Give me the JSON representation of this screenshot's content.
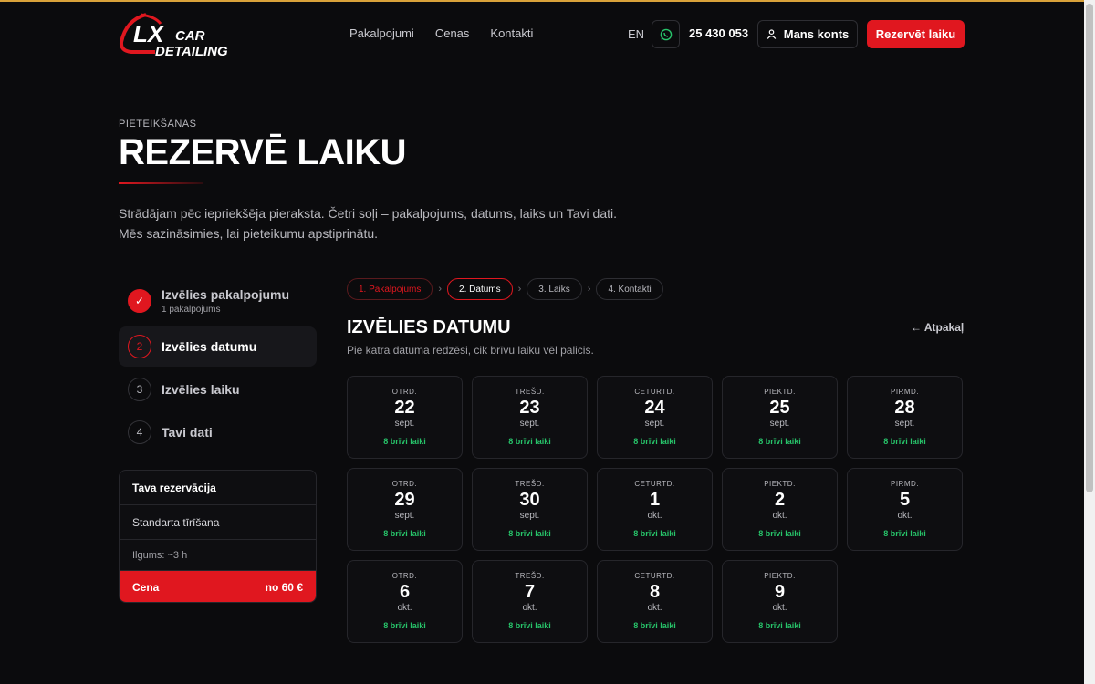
{
  "brand": {
    "logo_text_1": "LX",
    "logo_text_2": "CAR",
    "logo_text_3": "DETAILING"
  },
  "nav": [
    "Pakalpojumi",
    "Cenas",
    "Kontakti"
  ],
  "header": {
    "lang": "EN",
    "phone": "25 430 053",
    "account": "Mans konts",
    "reserve": "Rezervēt laiku"
  },
  "colors": {
    "accent": "#e0171f",
    "available": "#27c46a",
    "background": "#0b0b0d"
  },
  "hero": {
    "eyebrow": "PIETEIKŠANĀS",
    "title": "REZERVĒ LAIKU",
    "intro_1": "Strādājam pēc iepriekšēja pieraksta. Četri soļi – pakalpojums, datums, laiks un Tavi dati.",
    "intro_2": "Mēs sazināsimies, lai pieteikumu apstiprinātu."
  },
  "steps": [
    {
      "num": "✓",
      "label": "Izvēlies pakalpojumu",
      "sub": "1 pakalpojums"
    },
    {
      "num": "2",
      "label": "Izvēlies datumu"
    },
    {
      "num": "3",
      "label": "Izvēlies laiku"
    },
    {
      "num": "4",
      "label": "Tavi dati"
    }
  ],
  "summary": {
    "title": "Tava rezervācija",
    "service": "Standarta tīrīšana",
    "duration": "Ilgums: ~3 h",
    "price_label": "Cena",
    "price_value": "no 60 €"
  },
  "crumbs": [
    "1. Pakalpojums",
    "2. Datums",
    "3. Laiks",
    "4. Kontakti"
  ],
  "crumb_sep": "›",
  "section": {
    "title": "IZVĒLIES DATUMU",
    "back": "← Atpakaļ",
    "hint": "Pie katra datuma redzēsi, cik brīvu laiku vēl palicis."
  },
  "days": [
    {
      "dow": "OTRD.",
      "day": "22",
      "month": "sept.",
      "slots": "8 brīvi laiki"
    },
    {
      "dow": "TREŠD.",
      "day": "23",
      "month": "sept.",
      "slots": "8 brīvi laiki"
    },
    {
      "dow": "CETURTD.",
      "day": "24",
      "month": "sept.",
      "slots": "8 brīvi laiki"
    },
    {
      "dow": "PIEKTD.",
      "day": "25",
      "month": "sept.",
      "slots": "8 brīvi laiki"
    },
    {
      "dow": "PIRMD.",
      "day": "28",
      "month": "sept.",
      "slots": "8 brīvi laiki"
    },
    {
      "dow": "OTRD.",
      "day": "29",
      "month": "sept.",
      "slots": "8 brīvi laiki"
    },
    {
      "dow": "TREŠD.",
      "day": "30",
      "month": "sept.",
      "slots": "8 brīvi laiki"
    },
    {
      "dow": "CETURTD.",
      "day": "1",
      "month": "okt.",
      "slots": "8 brīvi laiki"
    },
    {
      "dow": "PIEKTD.",
      "day": "2",
      "month": "okt.",
      "slots": "8 brīvi laiki"
    },
    {
      "dow": "PIRMD.",
      "day": "5",
      "month": "okt.",
      "slots": "8 brīvi laiki"
    },
    {
      "dow": "OTRD.",
      "day": "6",
      "month": "okt.",
      "slots": "8 brīvi laiki"
    },
    {
      "dow": "TREŠD.",
      "day": "7",
      "month": "okt.",
      "slots": "8 brīvi laiki"
    },
    {
      "dow": "CETURTD.",
      "day": "8",
      "month": "okt.",
      "slots": "8 brīvi laiki"
    },
    {
      "dow": "PIEKTD.",
      "day": "9",
      "month": "okt.",
      "slots": "8 brīvi laiki"
    }
  ]
}
